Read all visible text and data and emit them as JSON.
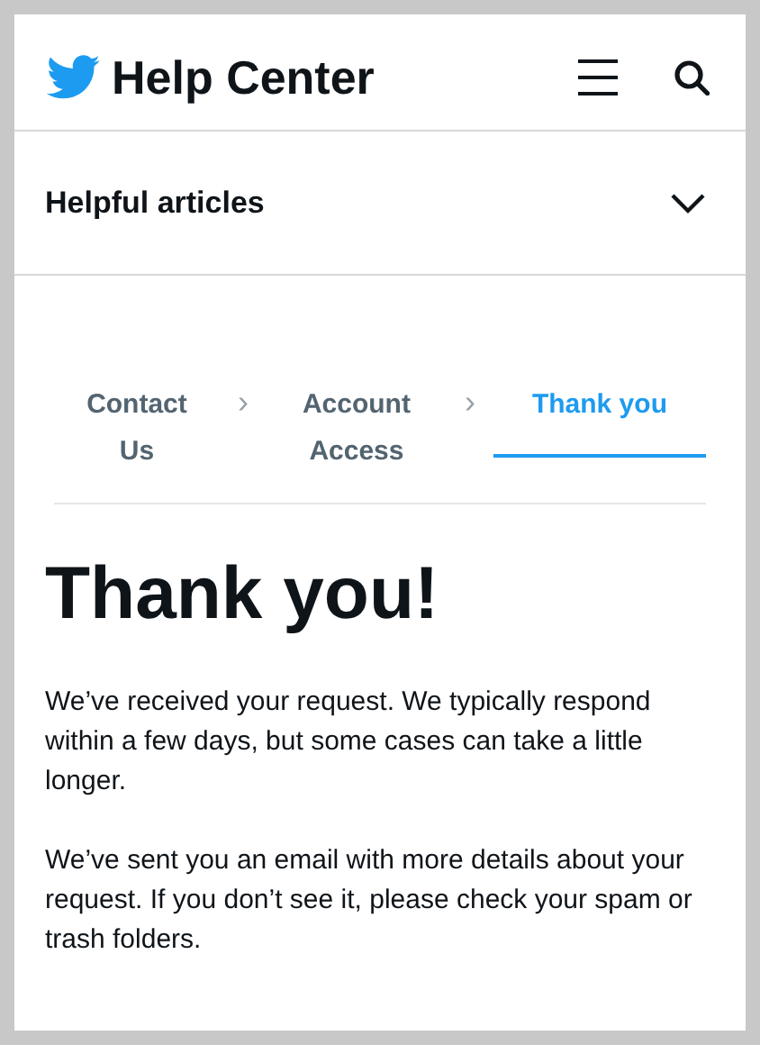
{
  "header": {
    "title": "Help Center"
  },
  "section": {
    "label": "Helpful articles",
    "expanded": false
  },
  "steps": [
    {
      "label": "Contact Us",
      "selected": false
    },
    {
      "label": "Account Access",
      "selected": false
    },
    {
      "label": "Thank you",
      "selected": true
    }
  ],
  "separator": "›",
  "heading": "Thank you!",
  "paragraphs": [
    "We’ve received your request. We typically respond within a few days, but some cases can take a little longer.",
    "We’ve sent you an email with more details about your request. If you don’t see it, please check your spam or trash folders."
  ]
}
